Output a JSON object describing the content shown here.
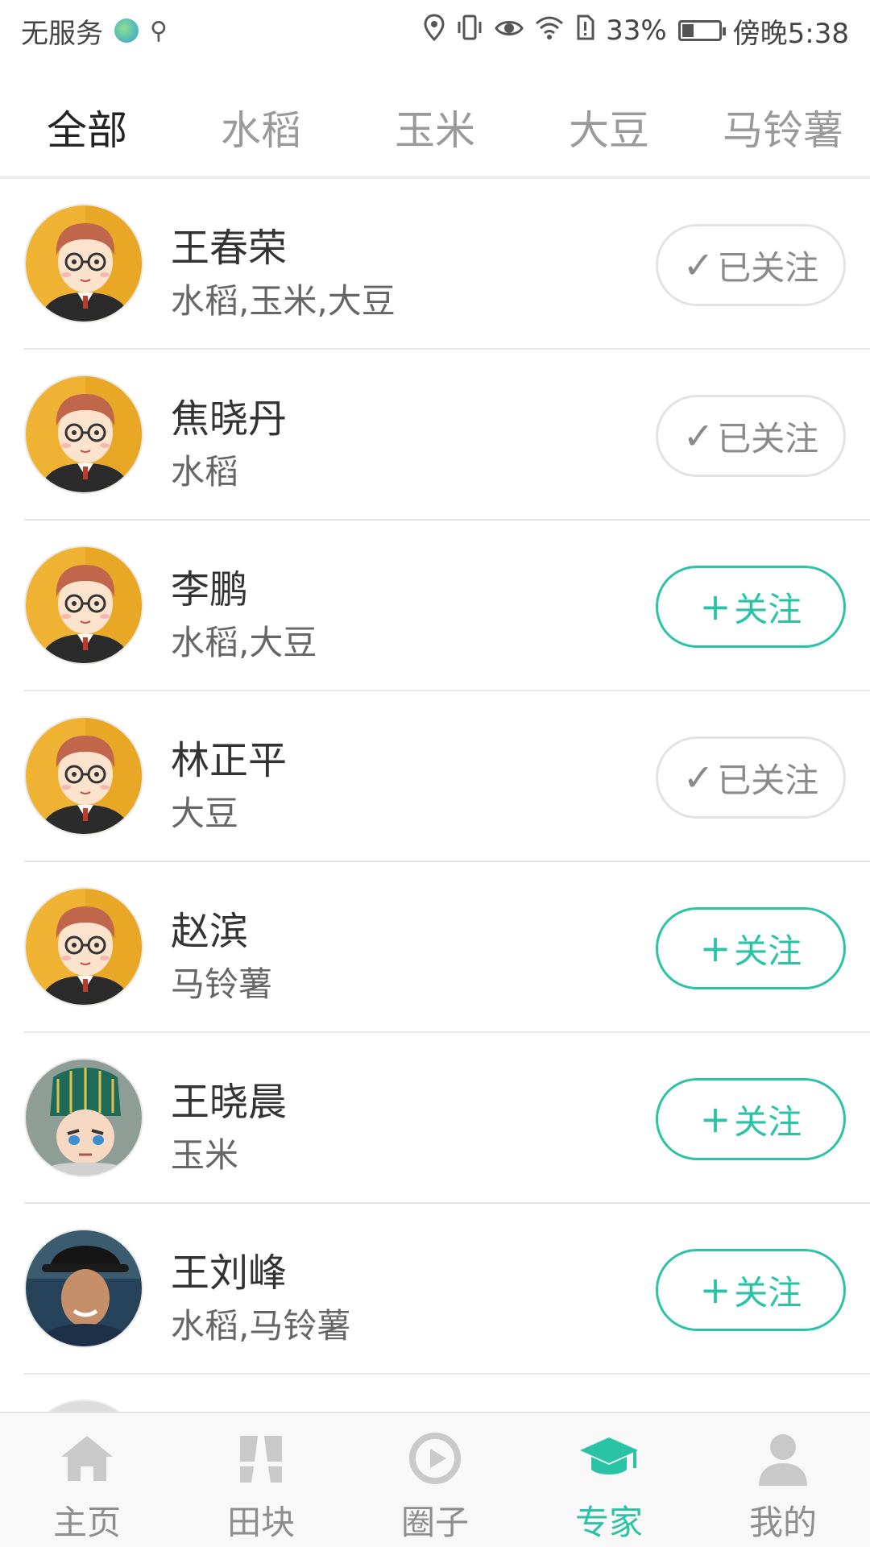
{
  "status_bar": {
    "carrier": "无服务",
    "battery_percent": "33%",
    "battery_level": 0.33,
    "time": "傍晚5:38",
    "icons": [
      "globe-icon",
      "usb-icon",
      "location-icon",
      "vibrate-icon",
      "eye-icon",
      "wifi-icon",
      "sim-alert-icon",
      "battery-icon"
    ]
  },
  "tabs": [
    {
      "label": "全部",
      "active": true
    },
    {
      "label": "水稻",
      "active": false
    },
    {
      "label": "玉米",
      "active": false
    },
    {
      "label": "大豆",
      "active": false
    },
    {
      "label": "马铃薯",
      "active": false
    }
  ],
  "experts": [
    {
      "name": "王春荣",
      "crops": "水稻,玉米,大豆",
      "followed": true,
      "button": "已关注",
      "avatar": "cartoon-man-avatar"
    },
    {
      "name": "焦晓丹",
      "crops": "水稻",
      "followed": true,
      "button": "已关注",
      "avatar": "cartoon-man-avatar"
    },
    {
      "name": "李鹏",
      "crops": "水稻,大豆",
      "followed": false,
      "button": "关注",
      "avatar": "cartoon-man-avatar"
    },
    {
      "name": "林正平",
      "crops": "大豆",
      "followed": true,
      "button": "已关注",
      "avatar": "cartoon-man-avatar"
    },
    {
      "name": "赵滨",
      "crops": "马铃薯",
      "followed": false,
      "button": "关注",
      "avatar": "cartoon-man-avatar"
    },
    {
      "name": "王晓晨",
      "crops": "玉米",
      "followed": false,
      "button": "关注",
      "avatar": "cartoon-warrior-avatar"
    },
    {
      "name": "王刘峰",
      "crops": "水稻,马铃薯",
      "followed": false,
      "button": "关注",
      "avatar": "photo-man-hat-avatar"
    }
  ],
  "bottom_nav": [
    {
      "label": "主页",
      "icon": "home-icon",
      "active": false
    },
    {
      "label": "田块",
      "icon": "field-icon",
      "active": false
    },
    {
      "label": "圈子",
      "icon": "circle-icon",
      "active": false
    },
    {
      "label": "专家",
      "icon": "graduation-cap-icon",
      "active": true
    },
    {
      "label": "我的",
      "icon": "user-icon",
      "active": false
    }
  ],
  "colors": {
    "accent": "#2ac3a5",
    "inactive": "#9a9a9a",
    "avatar_bg": "#f0b233"
  }
}
